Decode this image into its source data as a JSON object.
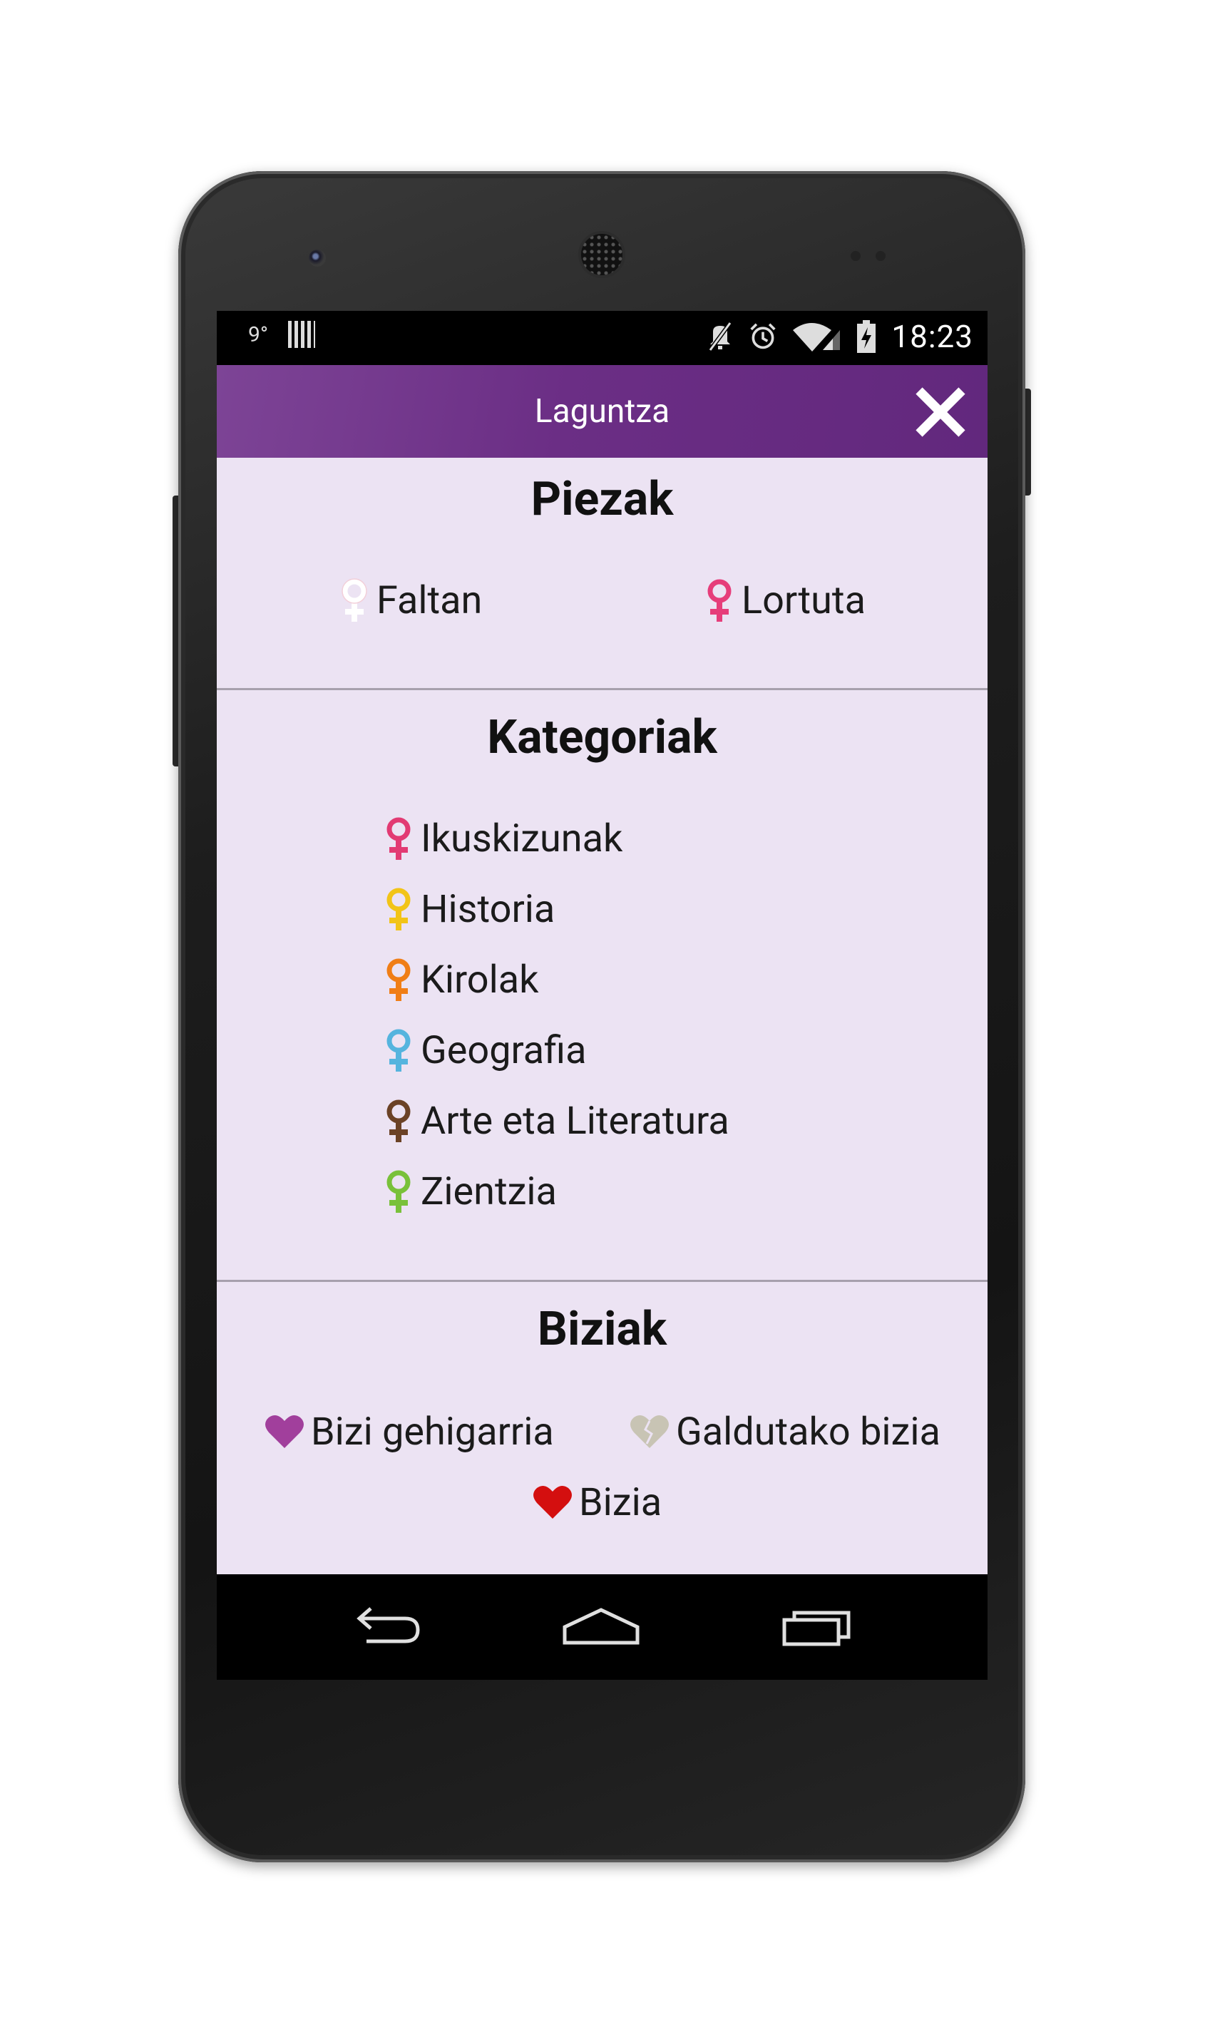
{
  "status_bar": {
    "temperature": "9°",
    "time": "18:23",
    "icons": [
      "barcode-icon",
      "mute-icon",
      "alarm-icon",
      "wifi-icon",
      "signal-icon",
      "battery-charging-icon"
    ]
  },
  "app_bar": {
    "title": "Laguntza",
    "close_icon": "close-icon"
  },
  "sections": {
    "piezak": {
      "title": "Piezak",
      "items": [
        {
          "label": "Faltan",
          "icon": "venus-icon",
          "color": "#ffffff"
        },
        {
          "label": "Lortuta",
          "icon": "venus-icon",
          "color": "#e63d7a"
        }
      ]
    },
    "kategoriak": {
      "title": "Kategoriak",
      "items": [
        {
          "label": "Ikuskizunak",
          "icon": "venus-icon",
          "color": "#e23a73"
        },
        {
          "label": "Historia",
          "icon": "venus-icon",
          "color": "#f2c417"
        },
        {
          "label": "Kirolak",
          "icon": "venus-icon",
          "color": "#f07e16"
        },
        {
          "label": "Geografia",
          "icon": "venus-icon",
          "color": "#55b4de"
        },
        {
          "label": "Arte eta Literatura",
          "icon": "venus-icon",
          "color": "#6b4226"
        },
        {
          "label": "Zientzia",
          "icon": "venus-icon",
          "color": "#79c13a"
        }
      ]
    },
    "biziak": {
      "title": "Biziak",
      "items": [
        {
          "label": "Bizi gehigarria",
          "icon": "heart-icon",
          "color": "#a13f9c"
        },
        {
          "label": "Galdutako bizia",
          "icon": "broken-heart-icon",
          "color": "#c8c4b4"
        },
        {
          "label": "Bizia",
          "icon": "heart-icon",
          "color": "#d40f0f"
        }
      ]
    }
  },
  "nav_bar": {
    "icons": [
      "back-icon",
      "home-icon",
      "recent-apps-icon"
    ]
  },
  "colors": {
    "app_bar": "#6b2e85",
    "content_background": "#ece3f3"
  }
}
